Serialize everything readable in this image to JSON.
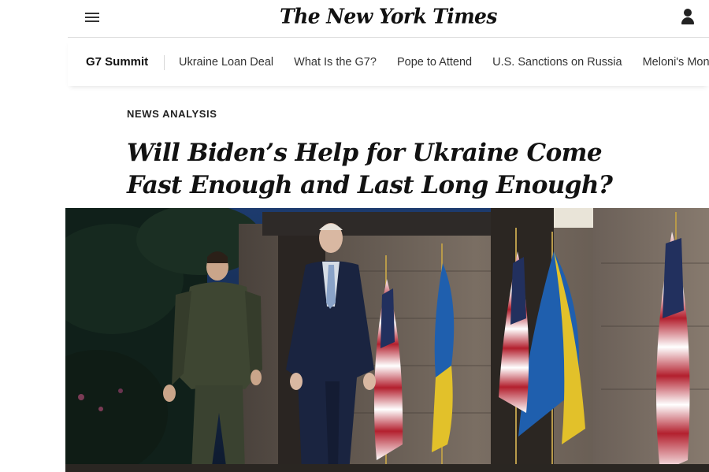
{
  "masthead": {
    "logo": "The New York Times",
    "menu_icon": "hamburger-menu-icon",
    "account_icon": "account-icon"
  },
  "section_nav": {
    "title": "G7 Summit",
    "items": [
      "Ukraine Loan Deal",
      "What Is the G7?",
      "Pope to Attend",
      "U.S. Sanctions on Russia",
      "Meloni's Mon"
    ]
  },
  "article": {
    "kicker": "NEWS ANALYSIS",
    "headline": "Will Biden’s Help for Ukraine Come Fast Enough and Last Long Enough?"
  },
  "photo": {
    "subject": "two-leaders-walking-past-flags"
  },
  "colors": {
    "text": "#121212",
    "divider": "#dfdfdf",
    "ukraine_blue": "#1f5fae",
    "ukraine_yellow": "#e2c12a",
    "us_red": "#b3202e"
  }
}
